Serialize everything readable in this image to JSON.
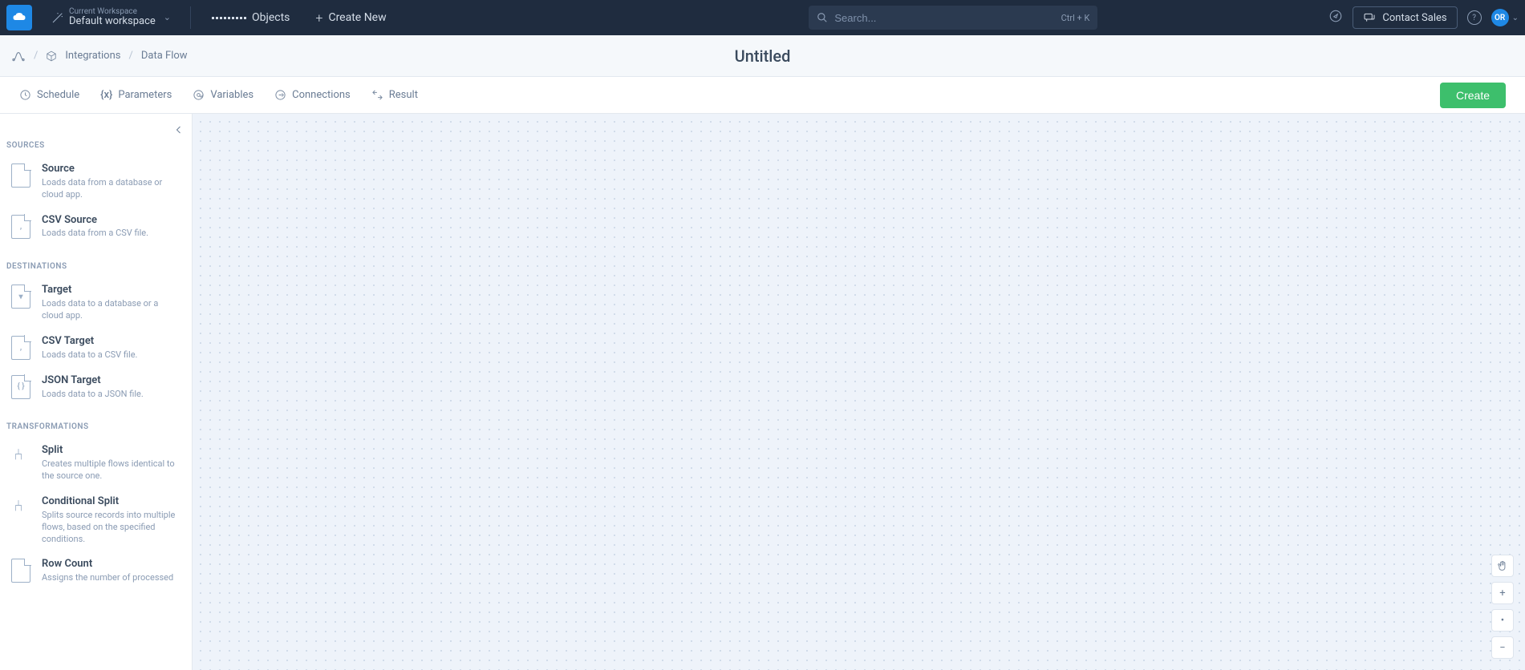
{
  "topnav": {
    "workspace_label": "Current Workspace",
    "workspace_name": "Default workspace",
    "objects_label": "Objects",
    "create_new_label": "Create New",
    "search_placeholder": "Search...",
    "search_shortcut": "Ctrl + K",
    "contact_label": "Contact Sales",
    "avatar_initials": "OR"
  },
  "breadcrumb": {
    "item1": "Integrations",
    "item2": "Data Flow",
    "title": "Untitled"
  },
  "tabs": {
    "schedule": "Schedule",
    "parameters": "Parameters",
    "variables": "Variables",
    "connections": "Connections",
    "result": "Result",
    "create_btn": "Create"
  },
  "sidebar": {
    "sections": [
      {
        "heading": "SOURCES",
        "items": [
          {
            "title": "Source",
            "desc": "Loads data from a database or cloud app.",
            "glyph": ""
          },
          {
            "title": "CSV Source",
            "desc": "Loads data from a CSV file.",
            "glyph": ","
          }
        ]
      },
      {
        "heading": "DESTINATIONS",
        "items": [
          {
            "title": "Target",
            "desc": "Loads data to a database or a cloud app.",
            "glyph": "▾"
          },
          {
            "title": "CSV Target",
            "desc": "Loads data to a CSV file.",
            "glyph": ","
          },
          {
            "title": "JSON Target",
            "desc": "Loads data to a JSON file.",
            "glyph": "{ }"
          }
        ]
      },
      {
        "heading": "TRANSFORMATIONS",
        "items": [
          {
            "title": "Split",
            "desc": "Creates multiple flows identical to the source one.",
            "glyph": "SPLIT"
          },
          {
            "title": "Conditional Split",
            "desc": "Splits source records into multiple flows, based on the specified conditions.",
            "glyph": "SPLIT"
          },
          {
            "title": "Row Count",
            "desc": "Assigns the number of processed",
            "glyph": ""
          }
        ]
      }
    ]
  }
}
